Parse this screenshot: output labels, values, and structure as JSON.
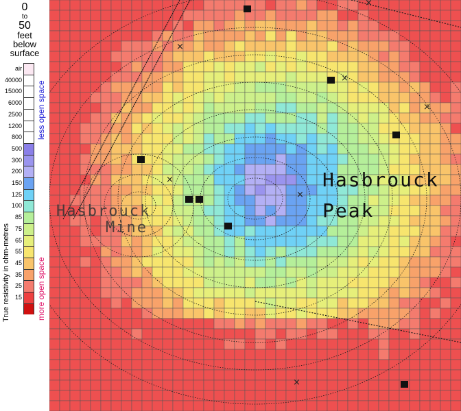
{
  "header": {
    "depth_from": "0",
    "depth_to_word": "to",
    "depth_to": "50",
    "depth_unit": "feet",
    "depth_below": "below",
    "depth_surface": "surface"
  },
  "legend": {
    "axis_title": "True resistivity in ohm-metres",
    "less_open": "less open space",
    "more_open": "more open space",
    "classes": [
      {
        "label": "air",
        "color": "#fbe8f2"
      },
      {
        "label": "40000",
        "color": "#ffffff"
      },
      {
        "label": "15000",
        "color": "#ffffff"
      },
      {
        "label": "6000",
        "color": "#ffffff"
      },
      {
        "label": "2500",
        "color": "#ffffff"
      },
      {
        "label": "1200",
        "color": "#ffffff"
      },
      {
        "label": "800",
        "color": "#ffffff"
      },
      {
        "label": "500",
        "color": "#8a7fe8"
      },
      {
        "label": "300",
        "color": "#9a94ee"
      },
      {
        "label": "200",
        "color": "#b3b0f5"
      },
      {
        "label": "150",
        "color": "#6aa3f2"
      },
      {
        "label": "125",
        "color": "#6fd1f6"
      },
      {
        "label": "100",
        "color": "#8fe8d6"
      },
      {
        "label": "85",
        "color": "#b5ef9a"
      },
      {
        "label": "75",
        "color": "#cdf08a"
      },
      {
        "label": "65",
        "color": "#e6ef7a"
      },
      {
        "label": "55",
        "color": "#f7e56e"
      },
      {
        "label": "45",
        "color": "#f9c46a"
      },
      {
        "label": "35",
        "color": "#f8a26a"
      },
      {
        "label": "25",
        "color": "#f47b6e"
      },
      {
        "label": "15",
        "color": "#ee4040"
      },
      {
        "label": "",
        "color": "#d01010"
      }
    ]
  },
  "map": {
    "label_peak_line1": "Hasbrouck",
    "label_peak_line2": "Peak",
    "label_mine_line1": "Hasbrouck",
    "label_mine_line2": "Mine"
  }
}
